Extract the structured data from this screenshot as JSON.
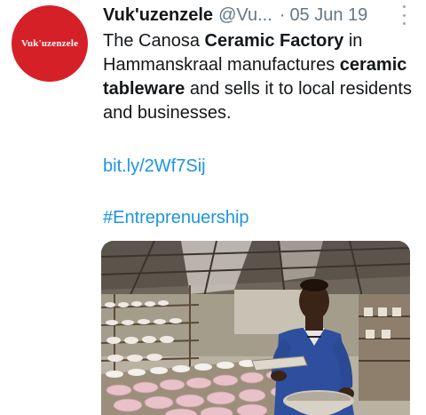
{
  "tweet": {
    "avatar_text": "Vuk'uzenzele",
    "display_name": "Vuk'uzenzele",
    "handle": "@Vu...",
    "separator": "·",
    "date": "05 Jun 19",
    "body": {
      "t1": "The Canosa ",
      "b1": "Ceramic Factory",
      "t2": " in Hammanskraal manufactures ",
      "b2": "ceramic tableware",
      "t3": " and sells it to local residents and businesses."
    },
    "link": "bit.ly/2Wf7Sij",
    "hashtag": "#Entreprenuership"
  },
  "colors": {
    "avatar": "#d62027",
    "link": "#1b95e0",
    "secondary_text": "#657786"
  },
  "icons": {
    "more": "more-vertical-icon"
  }
}
